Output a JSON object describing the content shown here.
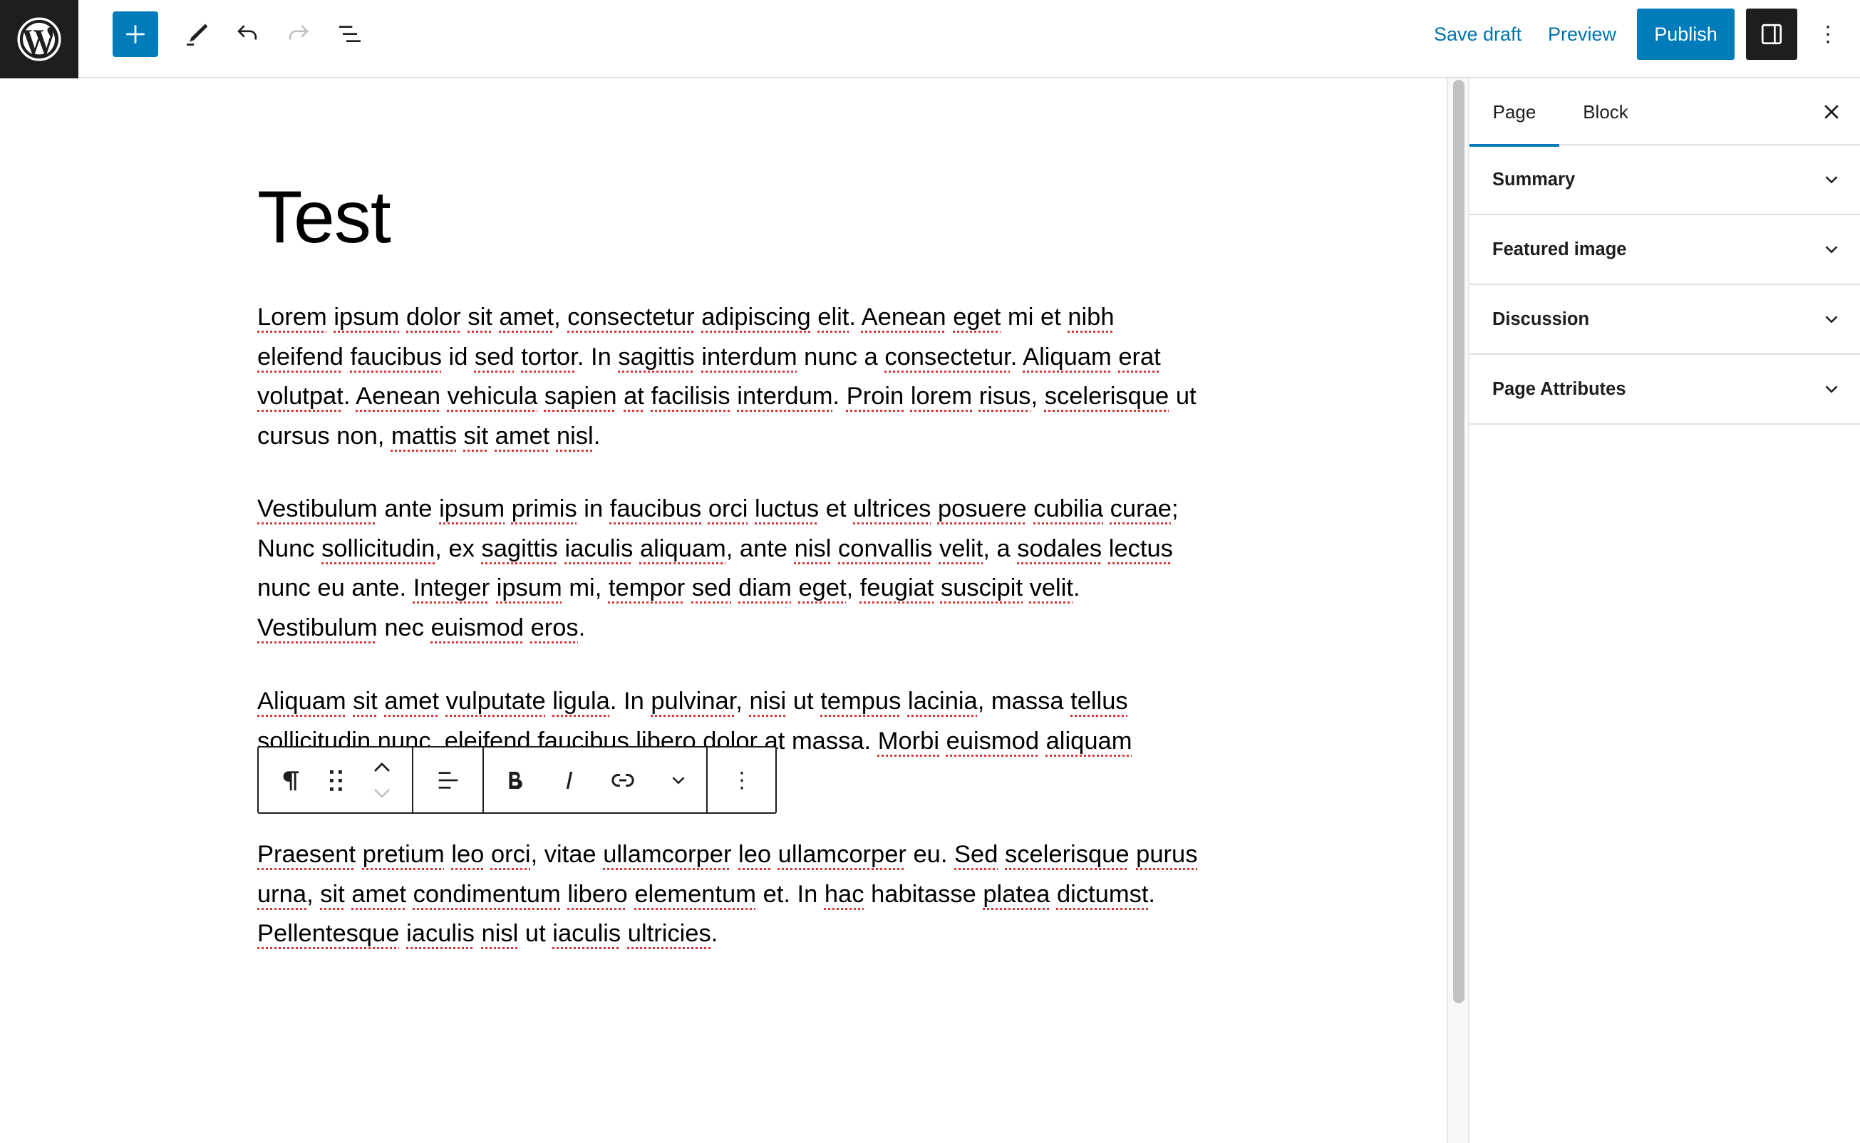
{
  "header": {
    "logo": "wordpress-logo",
    "toolbar": {
      "inserter_label": "Add block",
      "tools_label": "Tools",
      "undo_label": "Undo",
      "redo_label": "Redo",
      "outline_label": "Document overview"
    },
    "save_draft": "Save draft",
    "preview": "Preview",
    "publish": "Publish",
    "settings_label": "Settings",
    "options_label": "Options"
  },
  "editor": {
    "title": "Test",
    "paragraphs": [
      [
        {
          "t": "Lorem",
          "s": true
        },
        {
          "t": " "
        },
        {
          "t": "ipsum",
          "s": true
        },
        {
          "t": " "
        },
        {
          "t": "dolor",
          "s": true
        },
        {
          "t": " "
        },
        {
          "t": "sit",
          "s": true
        },
        {
          "t": " "
        },
        {
          "t": "amet",
          "s": true
        },
        {
          "t": ", "
        },
        {
          "t": "consectetur",
          "s": true
        },
        {
          "t": " "
        },
        {
          "t": "adipiscing",
          "s": true
        },
        {
          "t": " "
        },
        {
          "t": "elit",
          "s": true
        },
        {
          "t": ". "
        },
        {
          "t": "Aenean",
          "s": true
        },
        {
          "t": " "
        },
        {
          "t": "eget",
          "s": true
        },
        {
          "t": " mi et "
        },
        {
          "t": "nibh",
          "s": true
        },
        {
          "t": " "
        },
        {
          "t": "eleifend",
          "s": true
        },
        {
          "t": " "
        },
        {
          "t": "faucibus",
          "s": true
        },
        {
          "t": " id "
        },
        {
          "t": "sed",
          "s": true
        },
        {
          "t": " "
        },
        {
          "t": "tortor",
          "s": true
        },
        {
          "t": ". In "
        },
        {
          "t": "sagittis",
          "s": true
        },
        {
          "t": " "
        },
        {
          "t": "interdum",
          "s": true
        },
        {
          "t": " nunc a "
        },
        {
          "t": "consectetur",
          "s": true
        },
        {
          "t": ". "
        },
        {
          "t": "Aliquam",
          "s": true
        },
        {
          "t": " "
        },
        {
          "t": "erat",
          "s": true
        },
        {
          "t": " "
        },
        {
          "t": "volutpat",
          "s": true
        },
        {
          "t": ". "
        },
        {
          "t": "Aenean",
          "s": true
        },
        {
          "t": " "
        },
        {
          "t": "vehicula",
          "s": true
        },
        {
          "t": " "
        },
        {
          "t": "sapien",
          "s": true
        },
        {
          "t": " "
        },
        {
          "t": "at",
          "s": true
        },
        {
          "t": " "
        },
        {
          "t": "facilisis",
          "s": true
        },
        {
          "t": " "
        },
        {
          "t": "interdum",
          "s": true
        },
        {
          "t": ". "
        },
        {
          "t": "Proin",
          "s": true
        },
        {
          "t": " "
        },
        {
          "t": "lorem",
          "s": true
        },
        {
          "t": " "
        },
        {
          "t": "risus",
          "s": true
        },
        {
          "t": ", "
        },
        {
          "t": "scelerisque",
          "s": true
        },
        {
          "t": " "
        },
        {
          "t": "ut cursus non, "
        },
        {
          "t": "mattis",
          "s": true
        },
        {
          "t": " "
        },
        {
          "t": "sit",
          "s": true
        },
        {
          "t": " "
        },
        {
          "t": "amet",
          "s": true
        },
        {
          "t": " "
        },
        {
          "t": "nisl",
          "s": true
        },
        {
          "t": "."
        }
      ],
      [
        {
          "t": "Vestibulum",
          "s": true
        },
        {
          "t": " ante "
        },
        {
          "t": "ipsum",
          "s": true
        },
        {
          "t": " "
        },
        {
          "t": "primis",
          "s": true
        },
        {
          "t": " in "
        },
        {
          "t": "faucibus",
          "s": true
        },
        {
          "t": " "
        },
        {
          "t": "orci",
          "s": true
        },
        {
          "t": " "
        },
        {
          "t": "luctus",
          "s": true
        },
        {
          "t": " et "
        },
        {
          "t": "ultrices",
          "s": true
        },
        {
          "t": " "
        },
        {
          "t": "posuere",
          "s": true
        },
        {
          "t": " "
        },
        {
          "t": "cubilia",
          "s": true
        },
        {
          "t": " "
        },
        {
          "t": "curae",
          "s": true
        },
        {
          "t": "; Nunc "
        },
        {
          "t": "sollicitudin",
          "s": true
        },
        {
          "t": ", ex "
        },
        {
          "t": "sagittis",
          "s": true
        },
        {
          "t": " "
        },
        {
          "t": "iaculis",
          "s": true
        },
        {
          "t": " "
        },
        {
          "t": "aliquam",
          "s": true
        },
        {
          "t": ", ante "
        },
        {
          "t": "nisl",
          "s": true
        },
        {
          "t": " "
        },
        {
          "t": "convallis",
          "s": true
        },
        {
          "t": " "
        },
        {
          "t": "velit",
          "s": true
        },
        {
          "t": ", a "
        },
        {
          "t": "sodales",
          "s": true
        },
        {
          "t": " "
        },
        {
          "t": "lectus",
          "s": true
        },
        {
          "t": " nunc eu ante. "
        },
        {
          "t": "Integer",
          "s": true
        },
        {
          "t": " "
        },
        {
          "t": "ipsum",
          "s": true
        },
        {
          "t": " mi, "
        },
        {
          "t": "tempor",
          "s": true
        },
        {
          "t": " "
        },
        {
          "t": "sed",
          "s": true
        },
        {
          "t": " "
        },
        {
          "t": "diam",
          "s": true
        },
        {
          "t": " "
        },
        {
          "t": "eget",
          "s": true
        },
        {
          "t": ", "
        },
        {
          "t": "feugiat",
          "s": true
        },
        {
          "t": " "
        },
        {
          "t": "suscipit",
          "s": true
        },
        {
          "t": " "
        },
        {
          "t": "velit",
          "s": true
        },
        {
          "t": ". "
        },
        {
          "t": "Vestibulum",
          "s": true
        },
        {
          "t": " nec "
        },
        {
          "t": "euismod",
          "s": true
        },
        {
          "t": " "
        },
        {
          "t": "eros",
          "s": true
        },
        {
          "t": "."
        }
      ],
      [
        {
          "t": "Aliquam",
          "s": true
        },
        {
          "t": " "
        },
        {
          "t": "sit",
          "s": true
        },
        {
          "t": " "
        },
        {
          "t": "amet",
          "s": true
        },
        {
          "t": " "
        },
        {
          "t": "vulputate",
          "s": true
        },
        {
          "t": " "
        },
        {
          "t": "ligula",
          "s": true
        },
        {
          "t": ". In "
        },
        {
          "t": "pulvinar",
          "s": true
        },
        {
          "t": ", "
        },
        {
          "t": "nisi",
          "s": true
        },
        {
          "t": " ut "
        },
        {
          "t": "tempus",
          "s": true
        },
        {
          "t": " "
        },
        {
          "t": "lacinia",
          "s": true
        },
        {
          "t": ", massa "
        },
        {
          "t": "tellus",
          "s": true
        },
        {
          "t": " "
        },
        {
          "t": "sollicitudin",
          "s": true
        },
        {
          "t": " "
        },
        {
          "t": "nunc",
          "s": true
        },
        {
          "t": ". "
        },
        {
          "t": "eleifend",
          "s": true
        },
        {
          "t": " "
        },
        {
          "t": "faucibus",
          "s": true
        },
        {
          "t": " "
        },
        {
          "t": "libero",
          "s": true
        },
        {
          "t": " "
        },
        {
          "t": "dolor",
          "s": true
        },
        {
          "t": " at massa. "
        },
        {
          "t": "Morbi",
          "s": true
        },
        {
          "t": " "
        },
        {
          "t": "euismod",
          "s": true
        },
        {
          "t": " "
        },
        {
          "t": "aliquam",
          "s": true
        }
      ],
      [
        {
          "t": "Praesent",
          "s": true
        },
        {
          "t": " "
        },
        {
          "t": "pretium",
          "s": true
        },
        {
          "t": " "
        },
        {
          "t": "leo",
          "s": true
        },
        {
          "t": " "
        },
        {
          "t": "orci",
          "s": true
        },
        {
          "t": ", vitae "
        },
        {
          "t": "ullamcorper",
          "s": true
        },
        {
          "t": " "
        },
        {
          "t": "leo",
          "s": true
        },
        {
          "t": " "
        },
        {
          "t": "ullamcorper",
          "s": true
        },
        {
          "t": " eu. "
        },
        {
          "t": "Sed",
          "s": true
        },
        {
          "t": " "
        },
        {
          "t": "scelerisque",
          "s": true
        },
        {
          "t": " "
        },
        {
          "t": "purus",
          "s": true
        },
        {
          "t": " "
        },
        {
          "t": "urna",
          "s": true
        },
        {
          "t": ", "
        },
        {
          "t": "sit",
          "s": true
        },
        {
          "t": " "
        },
        {
          "t": "amet",
          "s": true
        },
        {
          "t": " "
        },
        {
          "t": "condimentum",
          "s": true
        },
        {
          "t": " "
        },
        {
          "t": "libero",
          "s": true
        },
        {
          "t": " "
        },
        {
          "t": "elementum",
          "s": true
        },
        {
          "t": " et. In "
        },
        {
          "t": "hac",
          "s": true
        },
        {
          "t": " habitasse "
        },
        {
          "t": "platea",
          "s": true
        },
        {
          "t": " "
        },
        {
          "t": "dictumst",
          "s": true
        },
        {
          "t": ". "
        },
        {
          "t": "Pellentesque",
          "s": true
        },
        {
          "t": " "
        },
        {
          "t": "iaculis",
          "s": true
        },
        {
          "t": " "
        },
        {
          "t": "nisl",
          "s": true
        },
        {
          "t": " ut "
        },
        {
          "t": "iaculis",
          "s": true
        },
        {
          "t": " "
        },
        {
          "t": "ultricies",
          "s": true
        },
        {
          "t": "."
        }
      ]
    ],
    "block_toolbar": {
      "block_type_label": "Paragraph",
      "drag_label": "Drag",
      "move_up_label": "Move up",
      "move_down_label": "Move down",
      "align_label": "Align text",
      "bold_label": "Bold",
      "italic_label": "Italic",
      "link_label": "Link",
      "more_formatting_label": "More",
      "options_label": "Options"
    }
  },
  "sidebar": {
    "tabs": [
      {
        "label": "Page",
        "active": true
      },
      {
        "label": "Block",
        "active": false
      }
    ],
    "close_label": "Close Settings",
    "panels": [
      {
        "label": "Summary"
      },
      {
        "label": "Featured image"
      },
      {
        "label": "Discussion"
      },
      {
        "label": "Page Attributes"
      }
    ]
  },
  "colors": {
    "accent": "#007cba",
    "dark": "#1e1e1e",
    "link": "#0073aa",
    "spellcheck": "#d63638",
    "border": "#e0e0e0"
  }
}
